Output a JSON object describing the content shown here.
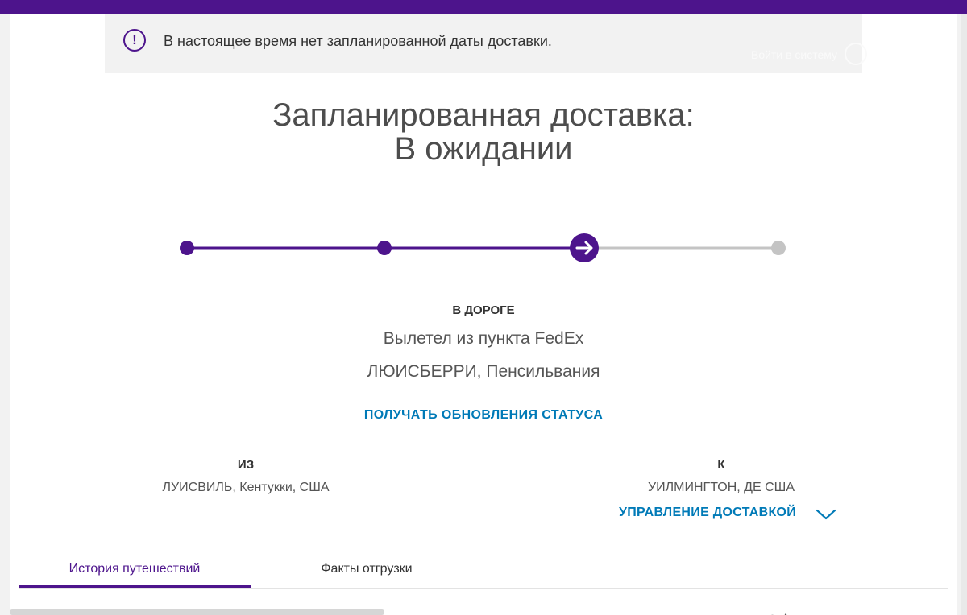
{
  "colors": {
    "brand_purple": "#4d148c",
    "link_blue": "#007ab7",
    "inactive_gray": "#c4c4c4"
  },
  "alert": {
    "icon": "exclamation-circle-icon",
    "text": "В настоящее время нет запланированной даты доставки.",
    "ghost_login": "Войти в систему",
    "ghost_icon": "user-avatar-icon"
  },
  "heading": {
    "line1": "Запланированная доставка:",
    "line2": "В ожидании"
  },
  "tracker": {
    "steps_total": 4,
    "completed_steps": 2,
    "current_step": 3,
    "current_icon": "arrow-right-icon"
  },
  "status": {
    "label": "В ДОРОГЕ",
    "description": "Вылетел из пункта FedEx",
    "location": "ЛЮИСБЕРРИ, Пенсильвания",
    "updates_link": "ПОЛУЧАТЬ ОБНОВЛЕНИЯ СТАТУСА"
  },
  "route": {
    "from_label": "ИЗ",
    "from_value": "ЛУИСВИЛЬ, Кентукки, США",
    "to_label": "К",
    "to_value": "УИЛМИНГТОН, ДЕ США",
    "manage_label": "УПРАВЛЕНИЕ ДОСТАВКОЙ",
    "manage_icon": "chevron-down-icon"
  },
  "tabs": [
    {
      "label": "История путешествий",
      "active": true
    },
    {
      "label": "Факты отгрузки",
      "active": false
    }
  ]
}
